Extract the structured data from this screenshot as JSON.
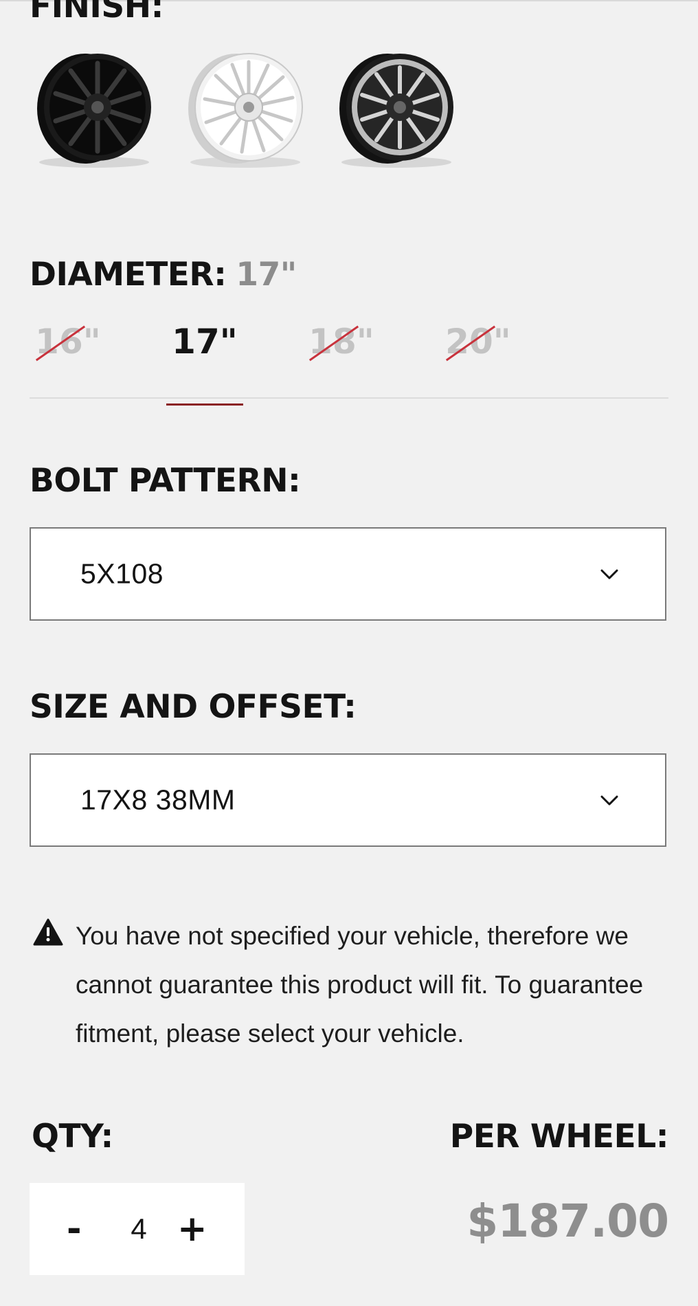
{
  "finish": {
    "heading": "FINISH:",
    "swatches": [
      {
        "icon": "wheel-black-icon",
        "color": "#151515"
      },
      {
        "icon": "wheel-silver-icon",
        "color": "#e3e3e3"
      },
      {
        "icon": "wheel-machined-icon",
        "color": "#2a2a2a"
      }
    ]
  },
  "diameter": {
    "heading": "DIAMETER:",
    "selected": "17\"",
    "options": [
      {
        "label": "16\"",
        "state": "unavailable"
      },
      {
        "label": "17\"",
        "state": "selected"
      },
      {
        "label": "18\"",
        "state": "unavailable"
      },
      {
        "label": "20\"",
        "state": "unavailable"
      }
    ]
  },
  "bolt_pattern": {
    "heading": "BOLT PATTERN:",
    "value": "5X108"
  },
  "size_offset": {
    "heading": "SIZE AND OFFSET:",
    "value": "17X8 38MM"
  },
  "warning": {
    "icon": "warning-icon",
    "text": "You have not specified your vehicle, therefore we cannot guarantee this product will fit. To guarantee fitment, please select your vehicle."
  },
  "qty": {
    "label": "QTY:",
    "minus": "-",
    "value": "4",
    "plus": "+"
  },
  "price": {
    "label": "PER WHEEL:",
    "value": "$187.00"
  },
  "colors": {
    "accent": "#8a1d22",
    "strike": "#c8323c",
    "muted": "#8e8e8e",
    "background": "#f1f1f1"
  }
}
